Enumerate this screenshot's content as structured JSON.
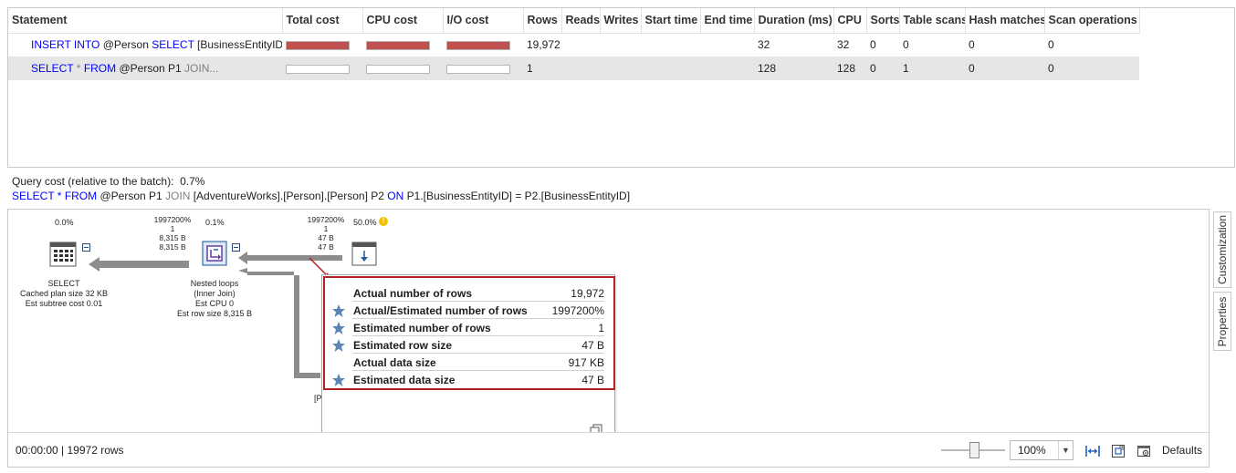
{
  "grid": {
    "columns": [
      "Statement",
      "Total cost",
      "CPU cost",
      "I/O cost",
      "Rows",
      "Reads",
      "Writes",
      "Start time",
      "End time",
      "Duration (ms)",
      "CPU",
      "Sorts",
      "Table scans",
      "Hash matches",
      "Scan operations"
    ],
    "rows": [
      {
        "stmt_kw1": "INSERT INTO",
        "stmt_mid": " @Person ",
        "stmt_kw2": "SELECT",
        "stmt_rest": " [BusinessEntityID],...",
        "total_cost_fill": 1.0,
        "cpu_cost_fill": 1.0,
        "io_cost_fill": 1.0,
        "rows": "19,972",
        "reads": "",
        "writes": "",
        "start_time": "",
        "end_time": "",
        "duration": "32",
        "cpu": "32",
        "sorts": "0",
        "table_scans": "0",
        "hash_matches": "0",
        "scan_operations": "0"
      },
      {
        "stmt_kw1": "SELECT",
        "stmt_gray1": " * ",
        "stmt_kw2": "FROM",
        "stmt_mid": " @Person P1 ",
        "stmt_gray2": "JOIN...",
        "total_cost_fill": 0.0,
        "cpu_cost_fill": 0.0,
        "io_cost_fill": 0.0,
        "rows": "1",
        "reads": "",
        "writes": "",
        "start_time": "",
        "end_time": "",
        "duration": "128",
        "cpu": "128",
        "sorts": "0",
        "table_scans": "1",
        "hash_matches": "0",
        "scan_operations": "0"
      }
    ],
    "bar_color": "#c0504d",
    "selected_row_bg": "#e6e6e6"
  },
  "query": {
    "cost_line": "Query cost (relative to the batch):  0.7%",
    "text": {
      "kw1": "SELECT",
      "g1": " * ",
      "kw2": "FROM",
      "p1": " @Person P1 ",
      "g2": "JOIN",
      "p2": " [AdventureWorks].[Person].[Person] P2 ",
      "kw3": "ON",
      "p3": " P1.[BusinessEntityID] = P2.[BusinessEntityID]"
    }
  },
  "plan": {
    "select_node": {
      "pct": "0.0%",
      "label": [
        "SELECT",
        "Cached plan size  32 KB",
        "Est subtree cost  0.01"
      ],
      "icon": "select-icon"
    },
    "loops_node": {
      "pct": "0.1%",
      "stats": [
        "1997200%",
        "1",
        "8,315 B",
        "8,315 B"
      ],
      "label": [
        "Nested loops",
        "(Inner Join)",
        "Est CPU  0",
        "Est row size  8,315 B"
      ],
      "icon": "nested-loops-icon"
    },
    "scan_node": {
      "pct": "50.0%",
      "stats": [
        "1997200%",
        "1",
        "47 B",
        "47 B"
      ],
      "icon": "table-scan-icon",
      "warning_icon": "warning-icon",
      "partial_label": "[P"
    },
    "tooltip": {
      "rows": [
        {
          "label": "Actual number of rows",
          "value": "19,972",
          "star": false
        },
        {
          "label": "Actual/Estimated number of rows",
          "value": "1997200%",
          "star": true
        },
        {
          "label": "Estimated number of rows",
          "value": "1",
          "star": true
        },
        {
          "label": "Estimated row size",
          "value": "47 B",
          "star": true
        },
        {
          "label": "Actual data size",
          "value": "917 KB",
          "star": false
        },
        {
          "label": "Estimated data size",
          "value": "47 B",
          "star": true
        }
      ],
      "highlight_color": "#b22222",
      "star_color": "#5a85b4"
    },
    "status": {
      "text": "00:00:00 | 19972 rows",
      "zoom": "100%",
      "defaults_label": "Defaults"
    },
    "side_tabs": [
      "Customization",
      "Properties"
    ]
  }
}
